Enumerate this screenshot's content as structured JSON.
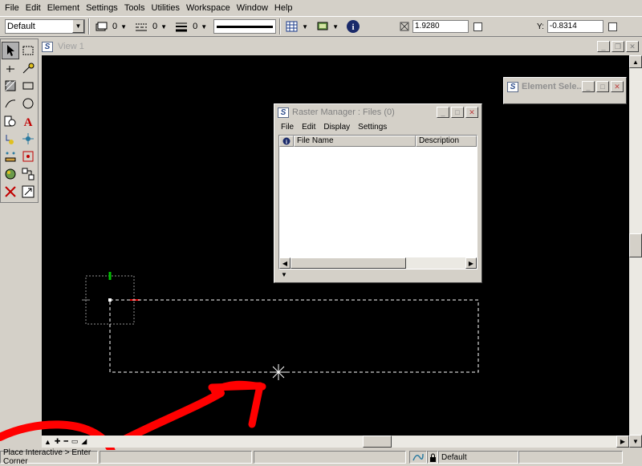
{
  "menubar": {
    "items": [
      "File",
      "Edit",
      "Element",
      "Settings",
      "Tools",
      "Utilities",
      "Workspace",
      "Window",
      "Help"
    ]
  },
  "toolbar": {
    "level_value": "Default",
    "color_value": "0",
    "style_value": "0",
    "weight_value": "0",
    "x_value": "1.9280",
    "y_label": "Y:",
    "y_value": "-0.8314"
  },
  "view": {
    "title": "View 1"
  },
  "raster_manager": {
    "title": "Raster Manager : Files (0)",
    "menu": [
      "File",
      "Edit",
      "Display",
      "Settings"
    ],
    "columns": [
      "File Name",
      "Description"
    ]
  },
  "element_selection": {
    "title": "Element Sele..."
  },
  "status": {
    "prompt": "Place Interactive > Enter Corner",
    "level": "Default"
  },
  "colors": {
    "canvas": "#000000",
    "window_bg": "#d4d0c8",
    "annotation": "#ff0000",
    "fence": "#ffffff",
    "handle_green": "#00c000",
    "handle_red": "#e00000"
  },
  "icons": {
    "select": "arrow-select-icon",
    "info": "info-icon",
    "lock": "lock-icon"
  }
}
